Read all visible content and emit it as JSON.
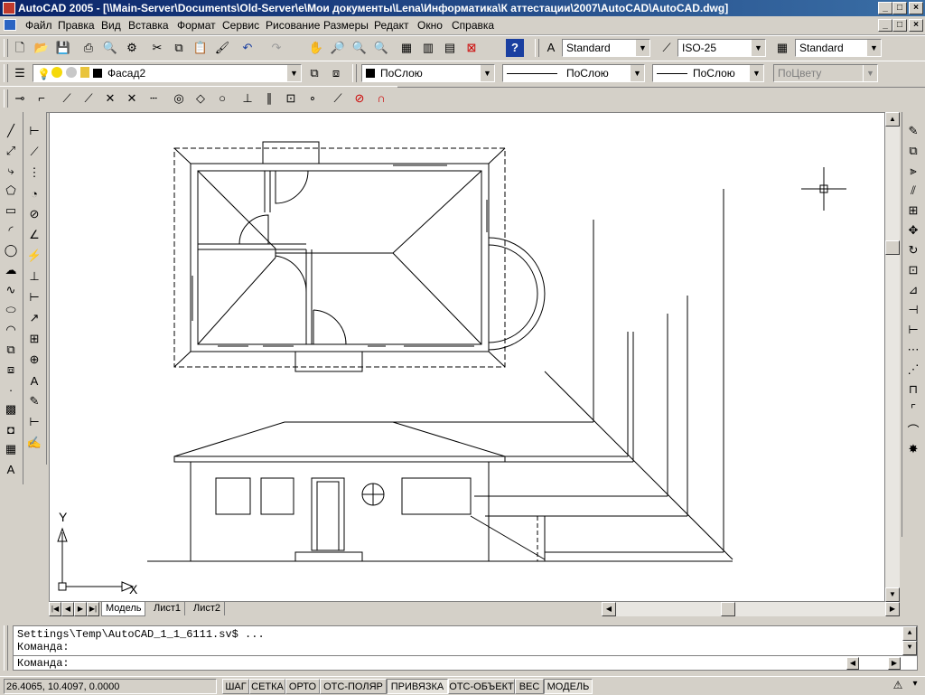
{
  "window": {
    "title": "AutoCAD 2005 - [\\\\Main-Server\\Documents\\Old-Server\\e\\Мои документы\\Lena\\Информатика\\К аттестации\\2007\\AutoCAD\\AutoCAD.dwg]"
  },
  "menu": [
    "Файл",
    "Правка",
    "Вид",
    "Вставка",
    "Формат",
    "Сервис",
    "Рисование",
    "Размеры",
    "Редакт",
    "Окно",
    "Справка"
  ],
  "styles": {
    "text_style": "Standard",
    "dim_style": "ISO-25",
    "table_style": "Standard"
  },
  "layers": {
    "current_layer": "Фасад2",
    "color": "ПоСлою",
    "linetype": "ПоСлою",
    "lineweight": "ПоСлою",
    "plotstyle": "ПоЦвету"
  },
  "ucs": {
    "x_label": "X",
    "y_label": "Y"
  },
  "tabs": [
    "Модель",
    "Лист1",
    "Лист2"
  ],
  "active_tab": "Модель",
  "command": {
    "history_line": "Settings\\Temp\\AutoCAD_1_1_6111.sv$ ...",
    "prompt_line": "Команда:",
    "input_label": "Команда:"
  },
  "status": {
    "coords": "26.4065, 10.4097, 0.0000",
    "toggles": [
      "ШАГ",
      "СЕТКА",
      "ОРТО",
      "ОТС-ПОЛЯР",
      "ПРИВЯЗКА",
      "ОТС-ОБЪЕКТ",
      "ВЕС",
      "МОДЕЛЬ"
    ],
    "active_toggles": [
      "ПРИВЯЗКА",
      "МОДЕЛЬ"
    ]
  },
  "icons": {
    "standard_toolbar": [
      "new-icon",
      "open-icon",
      "save-icon",
      "print-icon",
      "preview-icon",
      "publish-icon",
      "cut-icon",
      "copy-icon",
      "paste-icon",
      "match-props-icon",
      "undo-icon",
      "redo-icon",
      "pan-icon",
      "zoom-realtime-icon",
      "zoom-window-icon",
      "zoom-previous-icon",
      "properties-icon",
      "design-center-icon",
      "tool-palette-icon",
      "markup-icon",
      "help-icon"
    ],
    "draw_toolbar": [
      "line-icon",
      "xline-icon",
      "polyline-icon",
      "polygon-icon",
      "rectangle-icon",
      "arc-icon",
      "circle-icon",
      "revcloud-icon",
      "spline-icon",
      "ellipse-icon",
      "ellipse-arc-icon",
      "insert-block-icon",
      "make-block-icon",
      "point-icon",
      "hatch-icon",
      "region-icon",
      "table-icon",
      "mtext-icon"
    ],
    "modify_toolbar": [
      "erase-icon",
      "copy-object-icon",
      "mirror-icon",
      "offset-icon",
      "array-icon",
      "move-icon",
      "rotate-icon",
      "scale-icon",
      "stretch-icon",
      "trim-icon",
      "extend-icon",
      "break-point-icon",
      "break-icon",
      "join-icon",
      "chamfer-icon",
      "fillet-icon",
      "explode-icon"
    ],
    "colors": {
      "title_bar": "#0a246a",
      "face": "#d4d0c8",
      "canvas": "#ffffff",
      "drawing": "#000000"
    }
  }
}
